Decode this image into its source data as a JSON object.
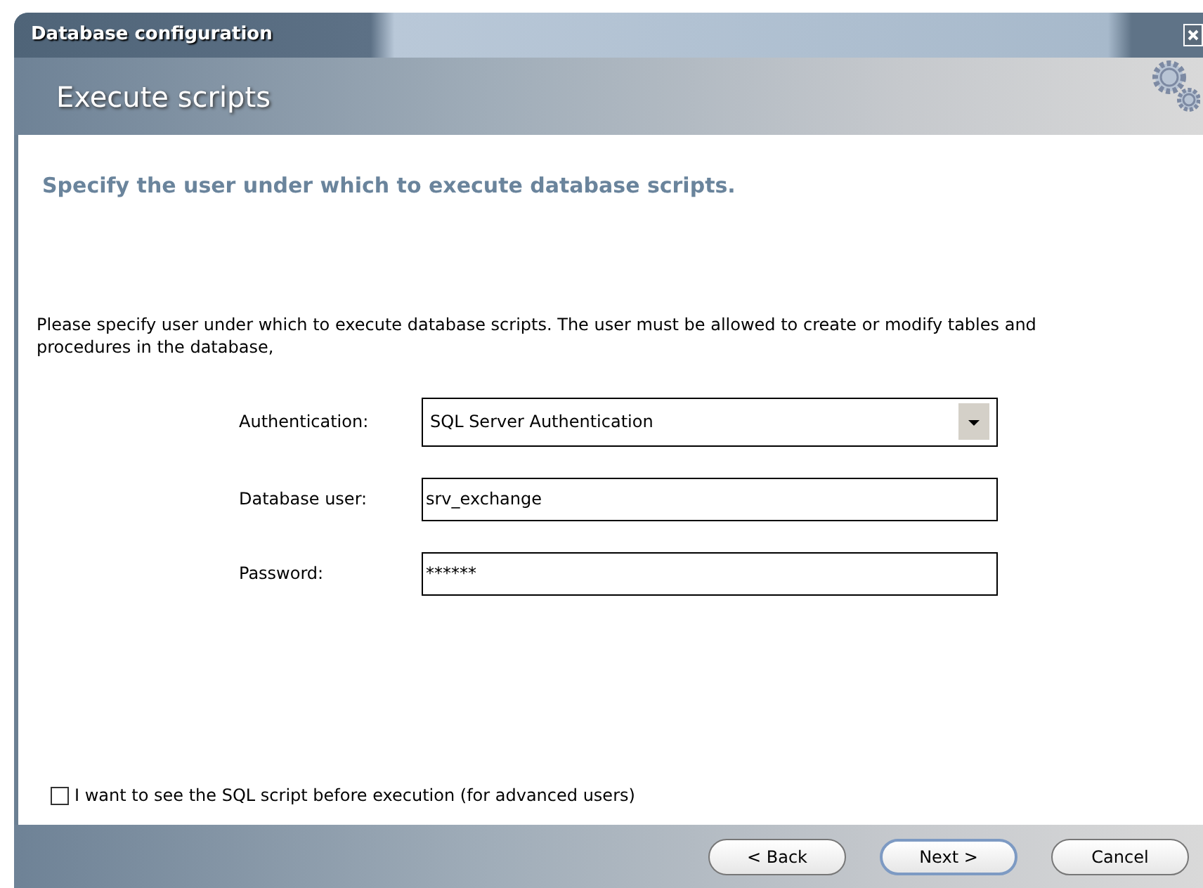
{
  "window": {
    "title": "Database configuration"
  },
  "header": {
    "title": "Execute scripts"
  },
  "heading": "Specify the user under which to execute database scripts.",
  "description": "Please specify user under which to execute database scripts. The user must be allowed to create or modify tables and procedures in the database,",
  "fields": [
    {
      "kind": "dropdown",
      "label": "Authentication:",
      "value": "SQL Server Authentication"
    },
    {
      "kind": "text",
      "label": "Database user:",
      "value": "srv_exchange"
    },
    {
      "kind": "text",
      "label": "Password:",
      "value": "******"
    }
  ],
  "checkbox": {
    "label": "I want to see the SQL script before execution (for advanced users)",
    "checked": false
  },
  "buttons": [
    {
      "label": "< Back",
      "default": false
    },
    {
      "label": "Next >",
      "default": true
    },
    {
      "label": "Cancel",
      "default": false
    }
  ]
}
